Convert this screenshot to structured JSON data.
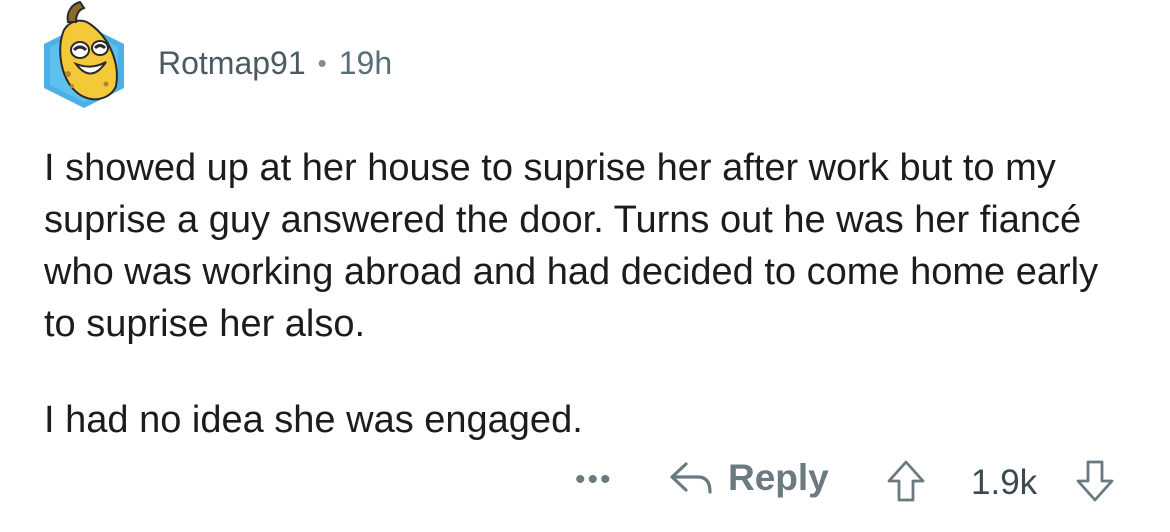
{
  "comment": {
    "username": "Rotmap91",
    "separator": "•",
    "time_ago": "19h",
    "paragraphs": [
      "I showed up at her house to suprise her after work but to my suprise a guy answered the door. Turns out he was her fiancé who was working abroad and had decided to come home early to suprise her also.",
      "I had no idea she was engaged."
    ]
  },
  "actions": {
    "more_label": "•••",
    "reply_label": "Reply",
    "score": "1.9k",
    "upvote_icon": "upvote-arrow-icon",
    "downvote_icon": "downvote-arrow-icon",
    "reply_icon": "reply-arrow-icon"
  },
  "colors": {
    "avatar_bg": "#4cb0e6",
    "avatar_face": "#f3c93a",
    "meta_text": "#576f76",
    "action_text": "#6a7a80"
  }
}
